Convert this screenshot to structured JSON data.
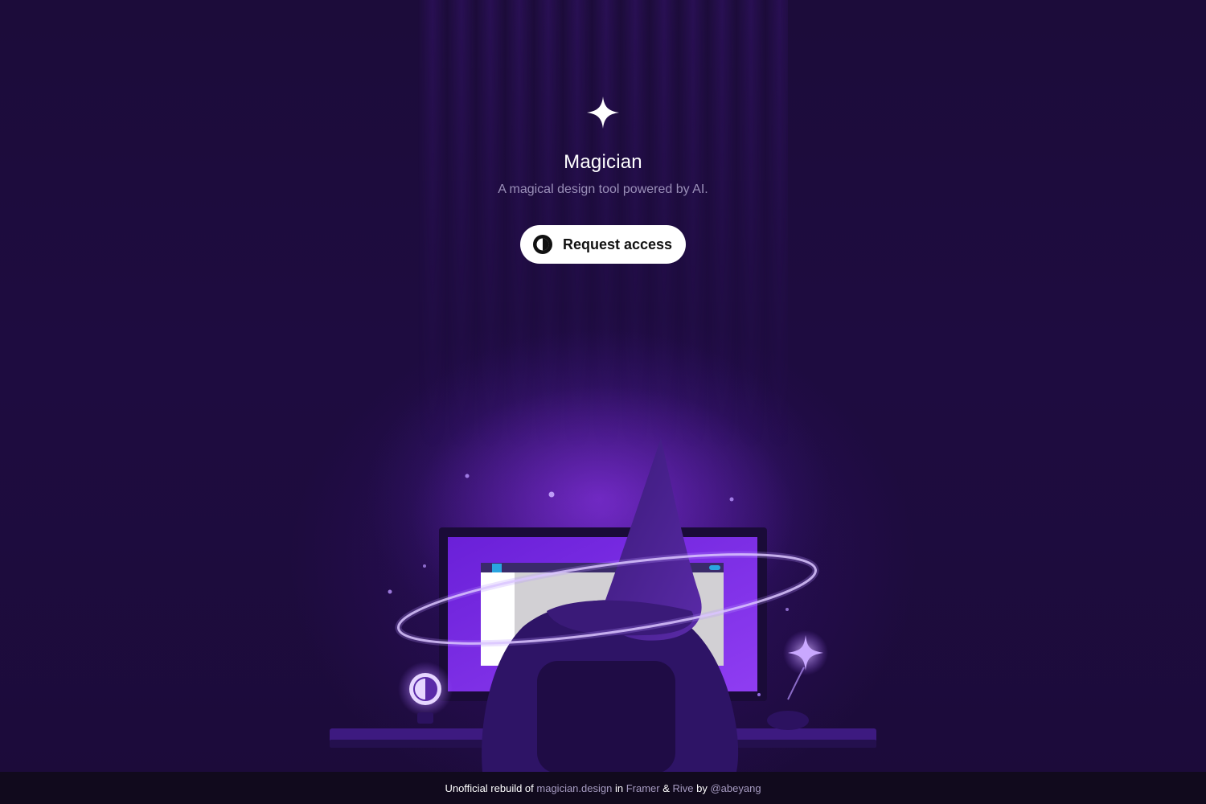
{
  "hero": {
    "logo_icon": "sparkle-icon",
    "title": "Magician",
    "subtitle": "A magical design tool powered by AI.",
    "cta_icon": "half-circle-icon",
    "cta_label": "Request access"
  },
  "illustration": {
    "description_icon": "wizard-at-desk-illustration"
  },
  "footer": {
    "prefix": "Unofficial rebuild of ",
    "link_site": "magician.design",
    "in_word": " in ",
    "link_framer": "Framer",
    "amp": " & ",
    "link_rive": "Rive",
    "by_word": " by ",
    "link_author": "@abeyang"
  },
  "colors": {
    "background": "#1c0c3a",
    "accent": "#7b2ff0",
    "footer_bg": "#110a1d",
    "footer_link": "#a69bc1",
    "button_bg": "#ffffff"
  }
}
